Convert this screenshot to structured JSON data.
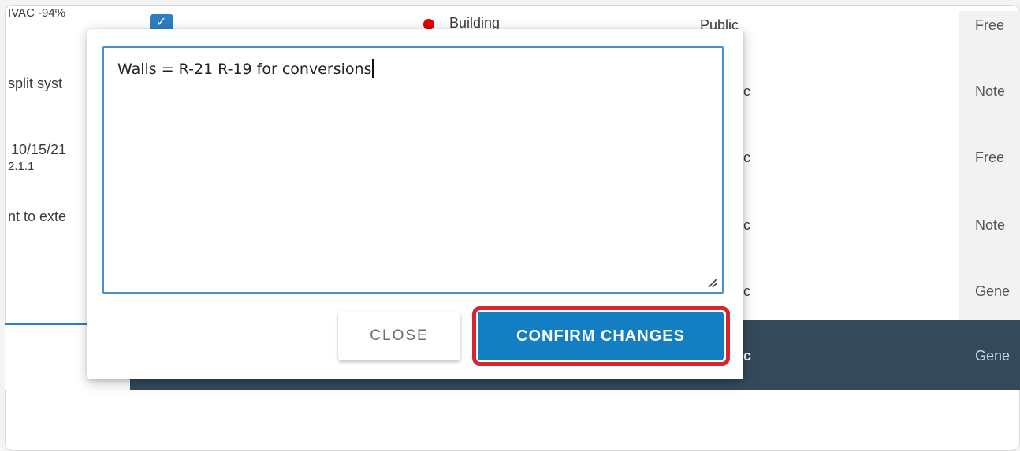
{
  "background": {
    "rows": [
      {
        "col1": "IVAC -94%",
        "status": "Building",
        "visibility": "Public",
        "type": "Free"
      },
      {
        "col1": "split syst",
        "visibility": "c",
        "type": "Note"
      },
      {
        "col1": "10/15/21",
        "col1_line2": "2.1.1",
        "visibility": "c",
        "type": "Free"
      },
      {
        "col1": "nt to exte",
        "visibility": "c",
        "type": "Note"
      },
      {
        "visibility": "c",
        "type": "Gene"
      }
    ],
    "selected_row": {
      "visibility": "c",
      "type": "Gene"
    }
  },
  "modal": {
    "text_value": "Walls = R-21 R-19 for conversions",
    "close_label": "CLOSE",
    "confirm_label": "CONFIRM CHANGES"
  },
  "colors": {
    "accent": "#137fc2",
    "highlight": "#d9262e",
    "dark_row": "#34495a",
    "status_dot": "#e20000"
  }
}
